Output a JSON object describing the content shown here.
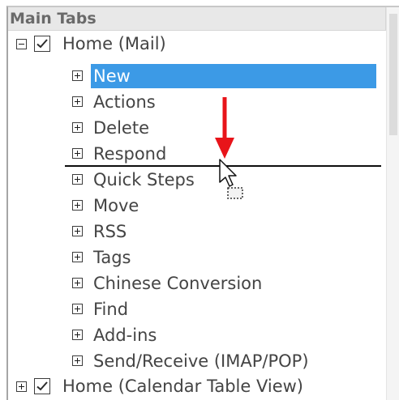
{
  "header": {
    "title": "Main Tabs"
  },
  "tree": {
    "home_mail": {
      "label": "Home (Mail)",
      "checked": true,
      "expanded": true
    },
    "groups": [
      {
        "label": "New",
        "selected": true
      },
      {
        "label": "Actions"
      },
      {
        "label": "Delete"
      },
      {
        "label": "Respond"
      },
      {
        "label": "Quick Steps"
      },
      {
        "label": "Move"
      },
      {
        "label": "RSS"
      },
      {
        "label": "Tags"
      },
      {
        "label": "Chinese Conversion"
      },
      {
        "label": "Find"
      },
      {
        "label": "Add-ins"
      },
      {
        "label": "Send/Receive (IMAP/POP)"
      }
    ],
    "home_calendar": {
      "label": "Home (Calendar Table View)",
      "checked": true,
      "expanded": false
    }
  },
  "drag": {
    "indicator_icon": "red-down-arrow-icon",
    "cursor_icon": "drag-move-cursor-icon",
    "arrow_color": "#e8141a"
  },
  "colors": {
    "selection": "#3c9ae6",
    "header_bg": "#e8e8e8"
  }
}
